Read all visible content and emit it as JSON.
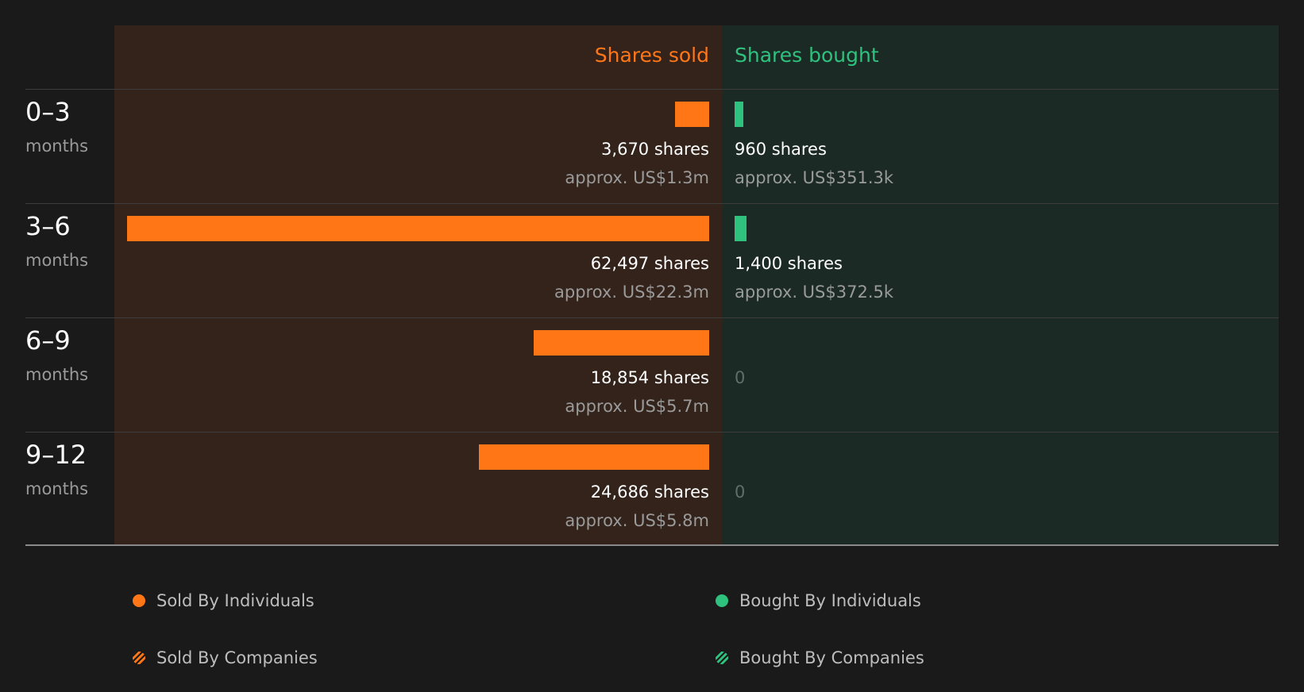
{
  "colors": {
    "sold": "#ff7617",
    "bought": "#2ec27e",
    "sold_panel": "#33231b",
    "bought_panel": "#1b2a24",
    "background": "#1a1a1a"
  },
  "chart_data": {
    "type": "bar",
    "orientation": "horizontal-diverging",
    "column_headers": {
      "sold": "Shares sold",
      "bought": "Shares bought"
    },
    "categories": [
      "0–3",
      "3–6",
      "6–9",
      "9–12"
    ],
    "category_unit": "months",
    "series": [
      {
        "name": "Shares sold",
        "values": [
          3670,
          62497,
          18854,
          24686
        ],
        "labels": [
          "3,670 shares",
          "62,497 shares",
          "18,854 shares",
          "24,686 shares"
        ],
        "usd_labels": [
          "approx. US$1.3m",
          "approx. US$22.3m",
          "approx. US$5.7m",
          "approx. US$5.8m"
        ]
      },
      {
        "name": "Shares bought",
        "values": [
          960,
          1400,
          0,
          0
        ],
        "labels": [
          "960 shares",
          "1,400 shares",
          "0",
          "0"
        ],
        "usd_labels": [
          "approx. US$351.3k",
          "approx. US$372.5k",
          "",
          ""
        ]
      }
    ],
    "xlim": [
      0,
      62497
    ],
    "legend": [
      {
        "label": "Sold By Individuals",
        "style": "solid",
        "color": "#ff7617"
      },
      {
        "label": "Bought By Individuals",
        "style": "solid",
        "color": "#2ec27e"
      },
      {
        "label": "Sold By Companies",
        "style": "hatched",
        "color": "#ff7617"
      },
      {
        "label": "Bought By Companies",
        "style": "hatched",
        "color": "#2ec27e"
      }
    ],
    "legend_position": "bottom"
  }
}
